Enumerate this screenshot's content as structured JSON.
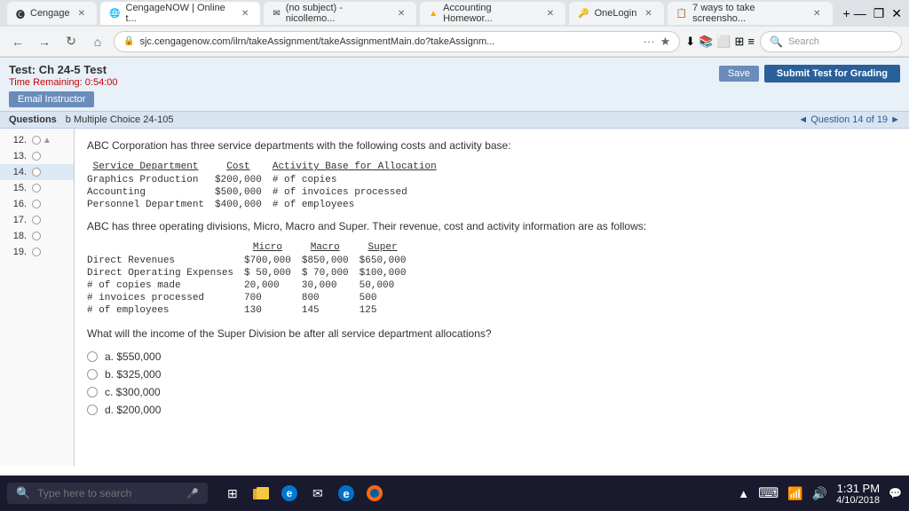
{
  "browser": {
    "tabs": [
      {
        "label": "Cengage",
        "active": false
      },
      {
        "label": "CengageNOW | Online t...",
        "active": true
      },
      {
        "label": "(no subject) - nicollemo...",
        "active": false
      },
      {
        "label": "Accounting Homewor...",
        "active": false
      },
      {
        "label": "OneLogin",
        "active": false
      },
      {
        "label": "7 ways to take screensho...",
        "active": false
      }
    ],
    "url": "sjc.cengagenow.com/ilrn/takeAssignment/takeAssignmentMain.do?takeAssignm...",
    "search_placeholder": "Search"
  },
  "header": {
    "title": "Test: Ch 24-5 Test",
    "timer_label": "Time Remaining:",
    "timer_value": "0:54:00",
    "email_btn": "Email Instructor",
    "save_btn": "Save",
    "submit_btn": "Submit Test for Grading"
  },
  "questions_bar": {
    "label": "Questions",
    "section": "b Multiple Choice 24-105",
    "nav": "◄ Question 14 of 19 ►"
  },
  "question_list": [
    {
      "num": "12.",
      "active": false
    },
    {
      "num": "13.",
      "active": false
    },
    {
      "num": "14.",
      "active": true
    },
    {
      "num": "15.",
      "active": false
    },
    {
      "num": "16.",
      "active": false
    },
    {
      "num": "17.",
      "active": false
    },
    {
      "num": "18.",
      "active": false
    },
    {
      "num": "19.",
      "active": false
    }
  ],
  "content": {
    "intro": "ABC Corporation has three service departments with the following costs and activity base:",
    "service_table": {
      "headers": [
        "Service Department",
        "Cost",
        "Activity Base for Allocation"
      ],
      "rows": [
        [
          "Graphics Production",
          "$200,000",
          "# of copies"
        ],
        [
          "Accounting",
          "$500,000",
          "# of invoices processed"
        ],
        [
          "Personnel Department",
          "$400,000",
          "# of employees"
        ]
      ]
    },
    "middle_text": "ABC has three operating divisions, Micro, Macro and Super. Their revenue, cost and activity information are as follows:",
    "ops_table": {
      "headers": [
        "",
        "Micro",
        "Macro",
        "Super"
      ],
      "rows": [
        [
          "Direct Revenues",
          "$700,000",
          "$850,000",
          "$650,000"
        ],
        [
          "Direct Operating Expenses",
          "$ 50,000",
          "$ 70,000",
          "$100,000"
        ],
        [
          "# of copies made",
          "20,000",
          "30,000",
          "50,000"
        ],
        [
          "# invoices processed",
          "700",
          "800",
          "500"
        ],
        [
          "# of employees",
          "130",
          "145",
          "125"
        ]
      ]
    },
    "question": "What will the income of the Super Division be after all service department allocations?",
    "choices": [
      {
        "label": "a. $550,000"
      },
      {
        "label": "b. $325,000"
      },
      {
        "label": "c. $300,000"
      },
      {
        "label": "d. $200,000"
      }
    ]
  },
  "taskbar": {
    "search_placeholder": "Type here to search",
    "time": "1:31 PM",
    "date": "4/10/2018"
  }
}
